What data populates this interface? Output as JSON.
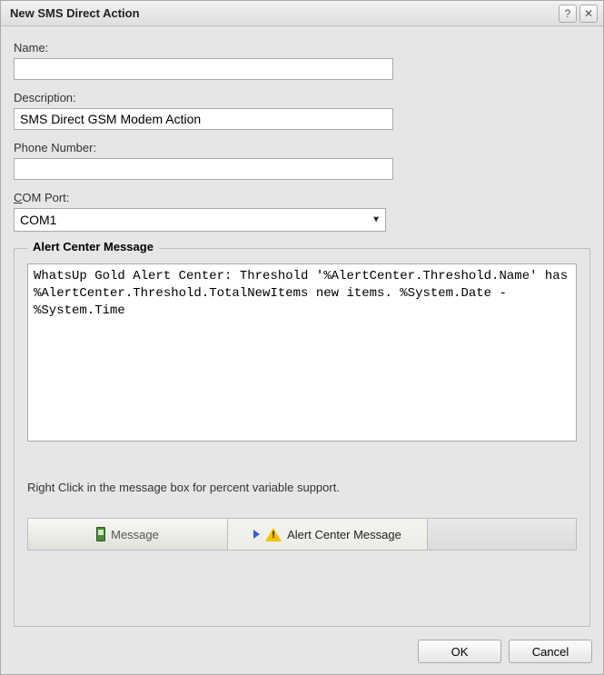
{
  "titlebar": {
    "title": "New SMS Direct Action"
  },
  "fields": {
    "name_label": "Name:",
    "name_value": "",
    "description_label": "Description:",
    "description_value": "SMS Direct GSM Modem Action",
    "phone_label": "Phone Number:",
    "phone_value": "",
    "comport_label_pre": "C",
    "comport_label_post": "OM Port:",
    "comport_value": "COM1"
  },
  "fieldset": {
    "legend": "Alert Center Message",
    "message_value": "WhatsUp Gold Alert Center: Threshold '%AlertCenter.Threshold.Name' has %AlertCenter.Threshold.TotalNewItems new items. %System.Date - %System.Time",
    "hint": "Right Click in the message box for percent variable support."
  },
  "tabs": {
    "message": "Message",
    "alert_center": "Alert Center Message"
  },
  "buttons": {
    "ok": "OK",
    "cancel": "Cancel"
  }
}
